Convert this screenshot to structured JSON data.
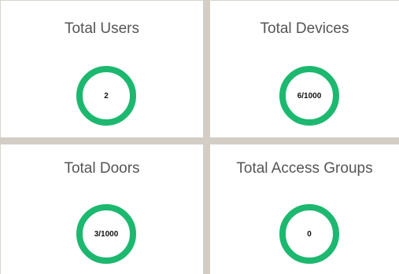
{
  "colors": {
    "ring": "#1db86f",
    "gutter": "#d3cdc6",
    "card": "#ffffff",
    "title_text": "#555555"
  },
  "cards": [
    {
      "title": "Total Users",
      "value": "2"
    },
    {
      "title": "Total Devices",
      "value": "6/1000"
    },
    {
      "title": "Total Doors",
      "value": "3/1000"
    },
    {
      "title": "Total Access Groups",
      "value": "0"
    }
  ]
}
